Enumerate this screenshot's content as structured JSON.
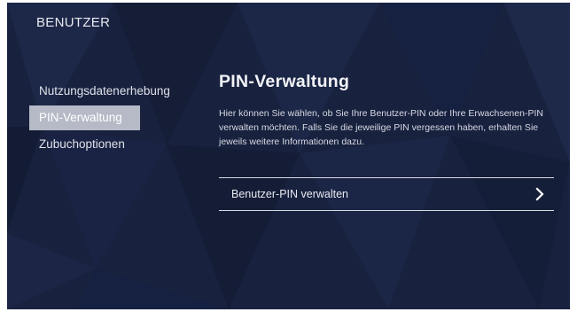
{
  "header": {
    "title": "BENUTZER"
  },
  "sidebar": {
    "items": [
      {
        "label": "Nutzungsdatenerhebung",
        "active": false
      },
      {
        "label": "PIN-Verwaltung",
        "active": true
      },
      {
        "label": "Zubuchoptionen",
        "active": false
      }
    ]
  },
  "main": {
    "title": "PIN-Verwaltung",
    "description": "Hier können Sie wählen, ob Sie Ihre Benutzer-PIN oder Ihre Erwachsenen-PIN verwalten möchten. Falls Sie die jeweilige PIN vergessen haben, erhalten Sie jeweils weitere Informationen dazu.",
    "action": {
      "label": "Benutzer-PIN verwalten",
      "icon": "chevron-right-icon"
    }
  },
  "colors": {
    "background": "#18213e",
    "active_item": "#b6bac7",
    "text": "#e8eaf0"
  }
}
